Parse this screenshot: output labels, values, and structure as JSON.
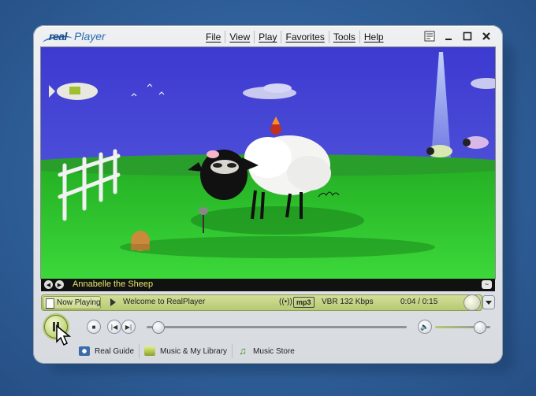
{
  "app": {
    "logo_real": "real",
    "logo_player": "Player"
  },
  "menu": [
    {
      "label": "File"
    },
    {
      "label": "View"
    },
    {
      "label": "Play"
    },
    {
      "label": "Favorites"
    },
    {
      "label": "Tools"
    },
    {
      "label": "Help"
    }
  ],
  "window_buttons": [
    "compact-icon",
    "minimize-icon",
    "maximize-icon",
    "close-icon"
  ],
  "caption": {
    "title": "Annabelle the Sheep"
  },
  "status": {
    "now_playing_label": "Now Playing",
    "welcome": "Welcome to RealPlayer",
    "format": "mp3",
    "bitrate": "VBR 132 Kbps",
    "time": "0:04 / 0:15"
  },
  "playback": {
    "seek_progress": 0.02,
    "volume_level": 0.7
  },
  "bottom_bar": [
    {
      "label": "Real Guide",
      "icon": "real-guide-icon"
    },
    {
      "label": "Music & My Library",
      "icon": "music-library-icon"
    },
    {
      "label": "Music Store",
      "icon": "music-store-icon"
    }
  ],
  "colors": {
    "accent_green": "#b5c872",
    "caption_text": "#e8e86a",
    "sky": "#4a48d6",
    "grass": "#2cc42e"
  }
}
